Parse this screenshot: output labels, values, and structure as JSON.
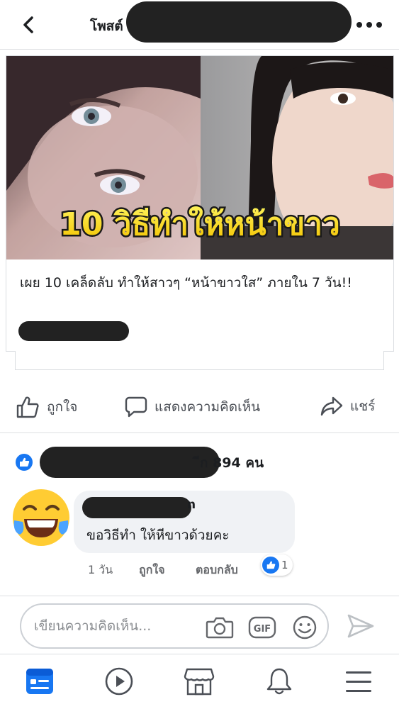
{
  "header": {
    "title": "โพสต์",
    "back_icon": "chevron-left-icon",
    "more_icon": "more-horizontal-icon"
  },
  "link_preview": {
    "overlay_text": "10 วิธีทำให้หน้าขาว",
    "title": "เผย 10 เคล็ดลับ ทำให้สาวๆ “หน้าขาวใส” ภายใน 7 วัน!!"
  },
  "actions": {
    "like": "ถูกใจ",
    "comment": "แสดงความคิดเห็น",
    "share": "แชร์"
  },
  "reactions": {
    "count_text": "ีก 894 คน"
  },
  "comment": {
    "author_suffix": "n",
    "text": "ขอวิธีทำ ให้หีขาวด้วยคะ",
    "time": "1 วัน",
    "like": "ถูกใจ",
    "reply": "ตอบกลับ",
    "like_count": "1"
  },
  "composer": {
    "placeholder": "เขียนความคิดเห็น..."
  },
  "nav": {
    "items": [
      "news-feed-icon",
      "watch-icon",
      "marketplace-icon",
      "notifications-icon",
      "menu-icon"
    ]
  },
  "colors": {
    "brand": "#1877f2",
    "text": "#1c1e21",
    "secondary_text": "#65676b",
    "divider": "#dddfe2",
    "bubble": "#f0f2f5"
  }
}
